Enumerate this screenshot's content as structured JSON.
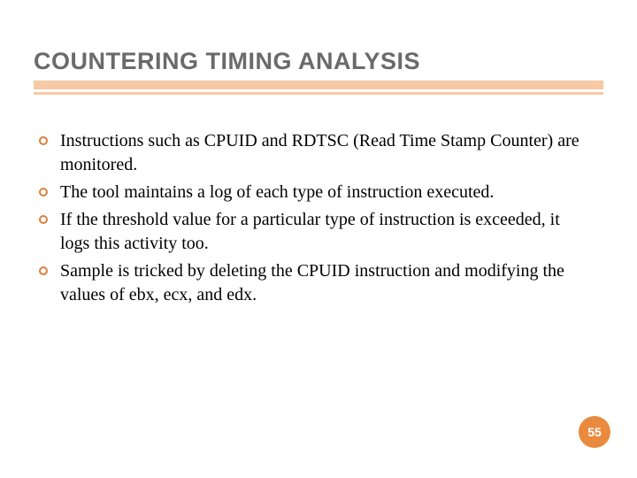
{
  "title": "COUNTERING TIMING ANALYSIS",
  "bullets": [
    "Instructions such as CPUID and RDTSC (Read Time Stamp Counter) are monitored.",
    "The tool maintains a log of each type of instruction executed.",
    "If the threshold value for a particular type of instruction is exceeded, it logs this activity too.",
    "Sample is tricked by deleting the CPUID instruction and modifying the values of ebx, ecx, and edx."
  ],
  "page_number": "55",
  "colors": {
    "title_text": "#6a6a6a",
    "underline": "#f7c9a5",
    "bullet_ring": "#dd7f3a",
    "badge_bg": "#e98a3f"
  }
}
